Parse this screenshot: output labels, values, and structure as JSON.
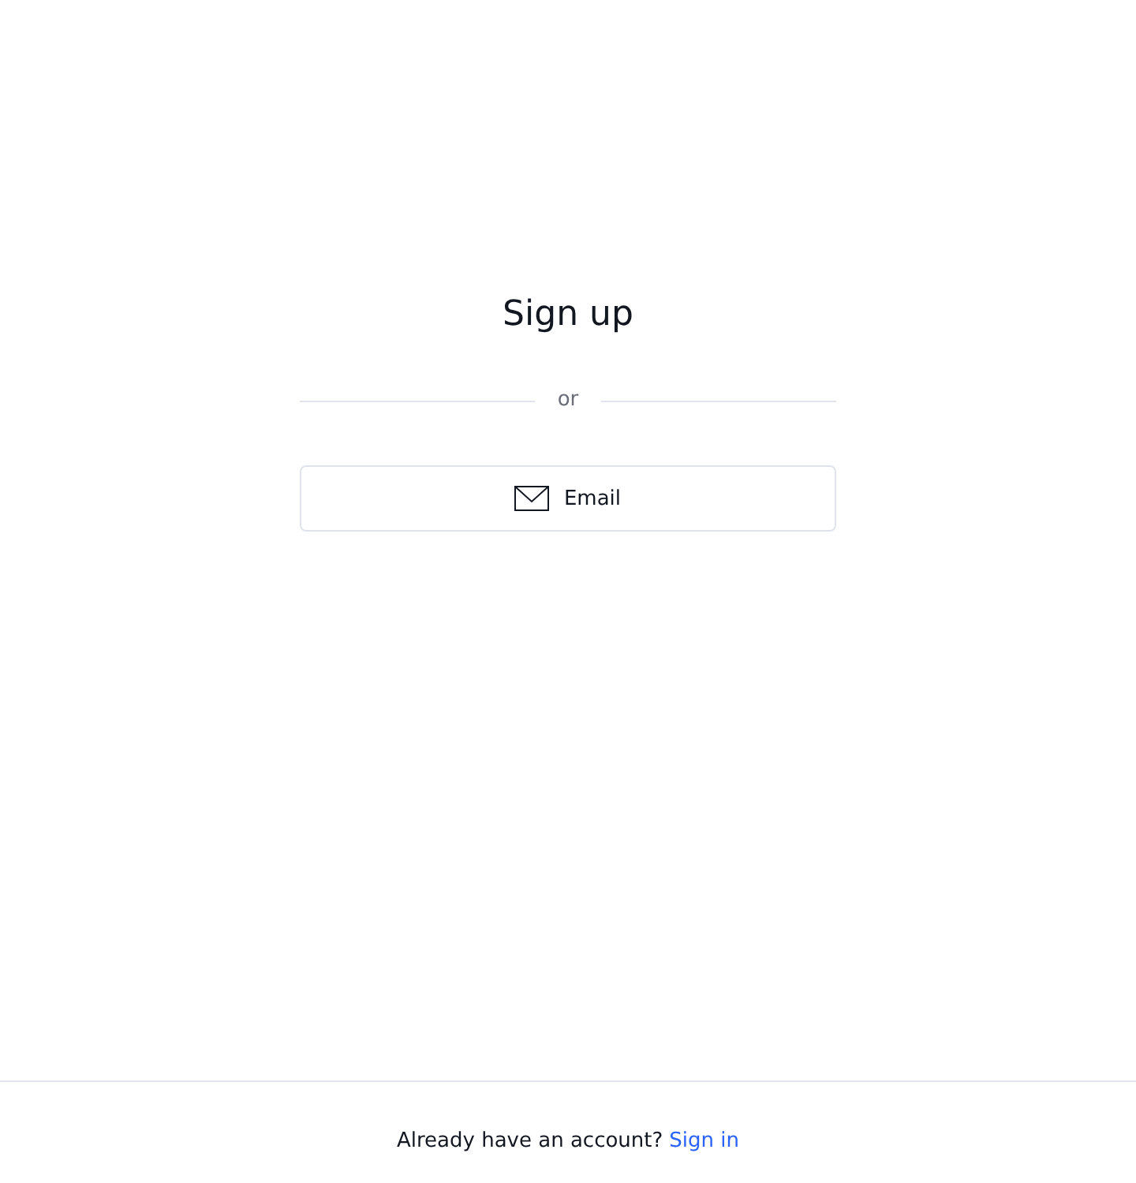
{
  "title": "Sign up",
  "divider": {
    "label": "or"
  },
  "buttons": [
    {
      "kind": "email",
      "label": "Email"
    }
  ],
  "footer": {
    "prompt": "Already have an account?",
    "link": "Sign in"
  }
}
